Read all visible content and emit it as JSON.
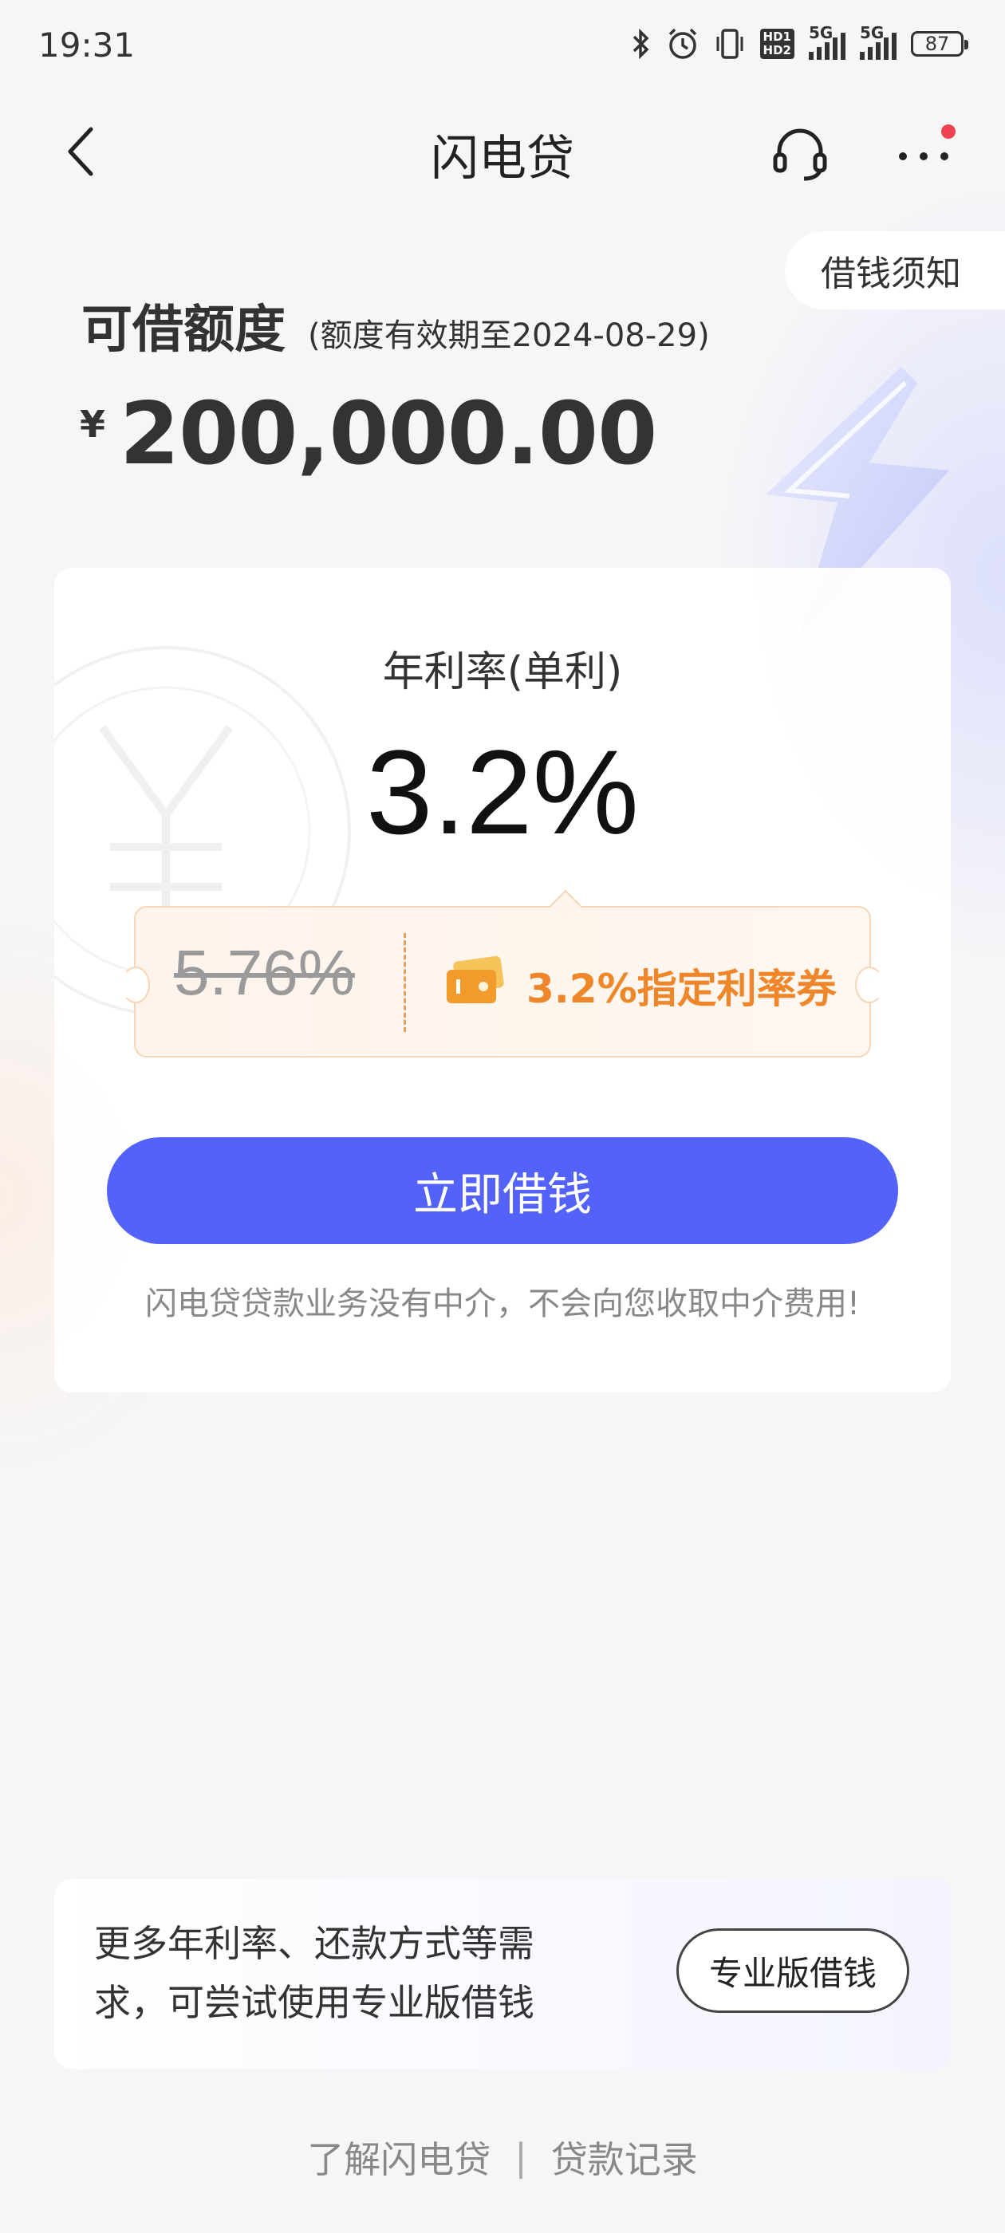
{
  "status_bar": {
    "time": "19:31",
    "battery": "87",
    "network_1": "5G",
    "network_2": "5G",
    "hd_top": "HD1",
    "hd_bottom": "HD2"
  },
  "nav": {
    "title": "闪电贷"
  },
  "notice_button": "借钱须知",
  "limit": {
    "title": "可借额度",
    "validity": "(额度有效期至2024-08-29)",
    "currency": "¥",
    "amount": "200,000.00"
  },
  "rate": {
    "label": "年利率(单利)",
    "value": "3.2%",
    "original_rate": "5.76%",
    "coupon_text": "3.2%指定利率券"
  },
  "borrow_button": "立即借钱",
  "disclaimer": "闪电贷贷款业务没有中介，不会向您收取中介费用!",
  "pro": {
    "text": "更多年利率、还款方式等需求，可尝试使用专业版借钱",
    "button": "专业版借钱"
  },
  "footer": {
    "link_about": "了解闪电贷",
    "separator": "|",
    "link_records": "贷款记录"
  },
  "colors": {
    "primary_button": "#5262fa",
    "coupon_accent": "#f0862a",
    "notification_dot": "#ef4150"
  }
}
